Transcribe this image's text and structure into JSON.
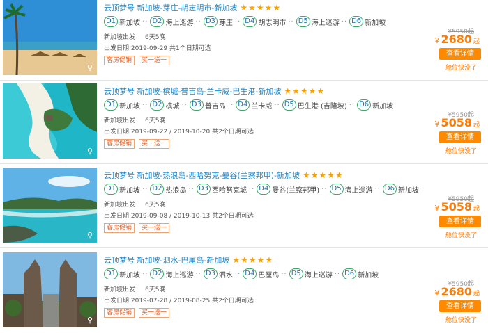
{
  "icons": {
    "zoom": "⚲",
    "stars": "★★★★★"
  },
  "colors": {
    "accent": "#ff8a00",
    "title": "#1f86c9",
    "day_border": "#3aa96b"
  },
  "cards": [
    {
      "title": "云顶梦号 新加坡-芽庄-胡志明市-新加坡",
      "rating": 5,
      "days": [
        {
          "d": "D1",
          "place": "新加坡"
        },
        {
          "d": "D2",
          "place": "海上巡游"
        },
        {
          "d": "D3",
          "place": "芽庄"
        },
        {
          "d": "D4",
          "place": "胡志明市"
        },
        {
          "d": "D5",
          "place": "海上巡游"
        },
        {
          "d": "D6",
          "place": "新加坡"
        }
      ],
      "departure": "新加坡出发",
      "duration": "6天5晚",
      "dates": "出发日期 2019-09-29 共1个日期可选",
      "tags": [
        "客房促销",
        "买一送一"
      ],
      "old_price": "¥5950起",
      "currency": "¥",
      "price": "2680",
      "price_suffix": "起",
      "button": "查看详情",
      "status": "舱位快没了"
    },
    {
      "title": "云顶梦号 新加坡-槟城-普吉岛-兰卡威-巴生港-新加坡",
      "rating": 5,
      "days": [
        {
          "d": "D1",
          "place": "新加坡"
        },
        {
          "d": "D2",
          "place": "槟城"
        },
        {
          "d": "D3",
          "place": "普吉岛"
        },
        {
          "d": "D4",
          "place": "兰卡威"
        },
        {
          "d": "D5",
          "place": "巴生港 (吉隆坡)"
        },
        {
          "d": "D6",
          "place": "新加坡"
        }
      ],
      "departure": "新加坡出发",
      "duration": "6天5晚",
      "dates": "出发日期 2019-09-22 / 2019-10-20 共2个日期可选",
      "tags": [
        "客房促销",
        "买一送一"
      ],
      "old_price": "¥5950起",
      "currency": "¥",
      "price": "5058",
      "price_suffix": "起",
      "button": "查看详情",
      "status": "舱位快没了"
    },
    {
      "title": "云顶梦号 新加坡-热浪岛-西哈努克-曼谷(兰察邦甲)-新加坡",
      "rating": 5,
      "days": [
        {
          "d": "D1",
          "place": "新加坡"
        },
        {
          "d": "D2",
          "place": "热浪岛"
        },
        {
          "d": "D3",
          "place": "西哈努克城"
        },
        {
          "d": "D4",
          "place": "曼谷(兰察邦甲)"
        },
        {
          "d": "D5",
          "place": "海上巡游"
        },
        {
          "d": "D6",
          "place": "新加坡"
        }
      ],
      "departure": "新加坡出发",
      "duration": "6天5晚",
      "dates": "出发日期 2019-09-08 / 2019-10-13 共2个日期可选",
      "tags": [
        "客房促销",
        "买一送一"
      ],
      "old_price": "¥5950起",
      "currency": "¥",
      "price": "5058",
      "price_suffix": "起",
      "button": "查看详情",
      "status": "舱位快没了"
    },
    {
      "title": "云顶梦号 新加坡-泗水-巴厘岛-新加坡",
      "rating": 5,
      "days": [
        {
          "d": "D1",
          "place": "新加坡"
        },
        {
          "d": "D2",
          "place": "海上巡游"
        },
        {
          "d": "D3",
          "place": "泗水"
        },
        {
          "d": "D4",
          "place": "巴厘岛"
        },
        {
          "d": "D5",
          "place": "海上巡游"
        },
        {
          "d": "D6",
          "place": "新加坡"
        }
      ],
      "departure": "新加坡出发",
      "duration": "6天5晚",
      "dates": "出发日期 2019-07-28 / 2019-08-25 共2个日期可选",
      "tags": [
        "客房促销",
        "买一送一"
      ],
      "old_price": "¥5950起",
      "currency": "¥",
      "price": "2680",
      "price_suffix": "起",
      "button": "查看详情",
      "status": "舱位快没了"
    }
  ]
}
